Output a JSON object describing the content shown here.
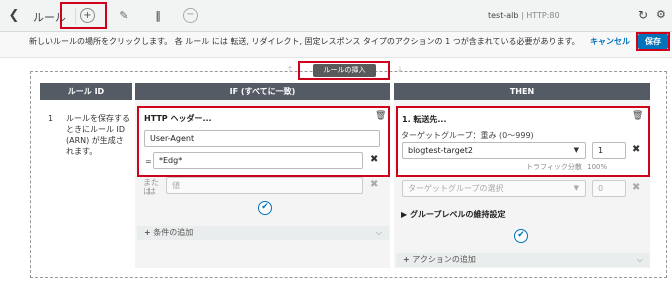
{
  "toolbar": {
    "title": "ルール",
    "lb_name": "test-alb",
    "lb_port": "| HTTP:80"
  },
  "infobar": {
    "message": "新しいルールの場所をクリックします。 各 ルール には 転送, リダイレクト, 固定レスポンス タイプのアクションの 1 つが含まれている必要があります。",
    "cancel": "キャンセル",
    "save": "保存"
  },
  "insert_button": "ルールの挿入",
  "columns": {
    "rule_id": "ルール ID",
    "if": "IF (すべてに一致)",
    "then": "THEN"
  },
  "rule": {
    "number": "1",
    "info": "ルールを保存するときにルール ID (ARN) が生成されます。"
  },
  "condition": {
    "title": "HTTP ヘッダー...",
    "header_name": "User-Agent",
    "operator": "=",
    "value": "*Edg*",
    "or_label": "または",
    "value_placeholder": "値",
    "add_condition": "条件の追加"
  },
  "action": {
    "title": "1. 転送先...",
    "target_group_label": "ターゲットグループ：重み (0〜999)",
    "target_group": "blogtest-target2",
    "weight": "1",
    "traffic_label": "トラフィック分散",
    "traffic_value": "100%",
    "select_placeholder": "ターゲットグループの選択",
    "weight_placeholder": "0",
    "stickiness": "グループレベルの維持設定",
    "add_action": "アクションの追加"
  },
  "colors": {
    "accent": "#0073bb",
    "highlight": "#d0021b",
    "header_bg": "#545b64"
  }
}
